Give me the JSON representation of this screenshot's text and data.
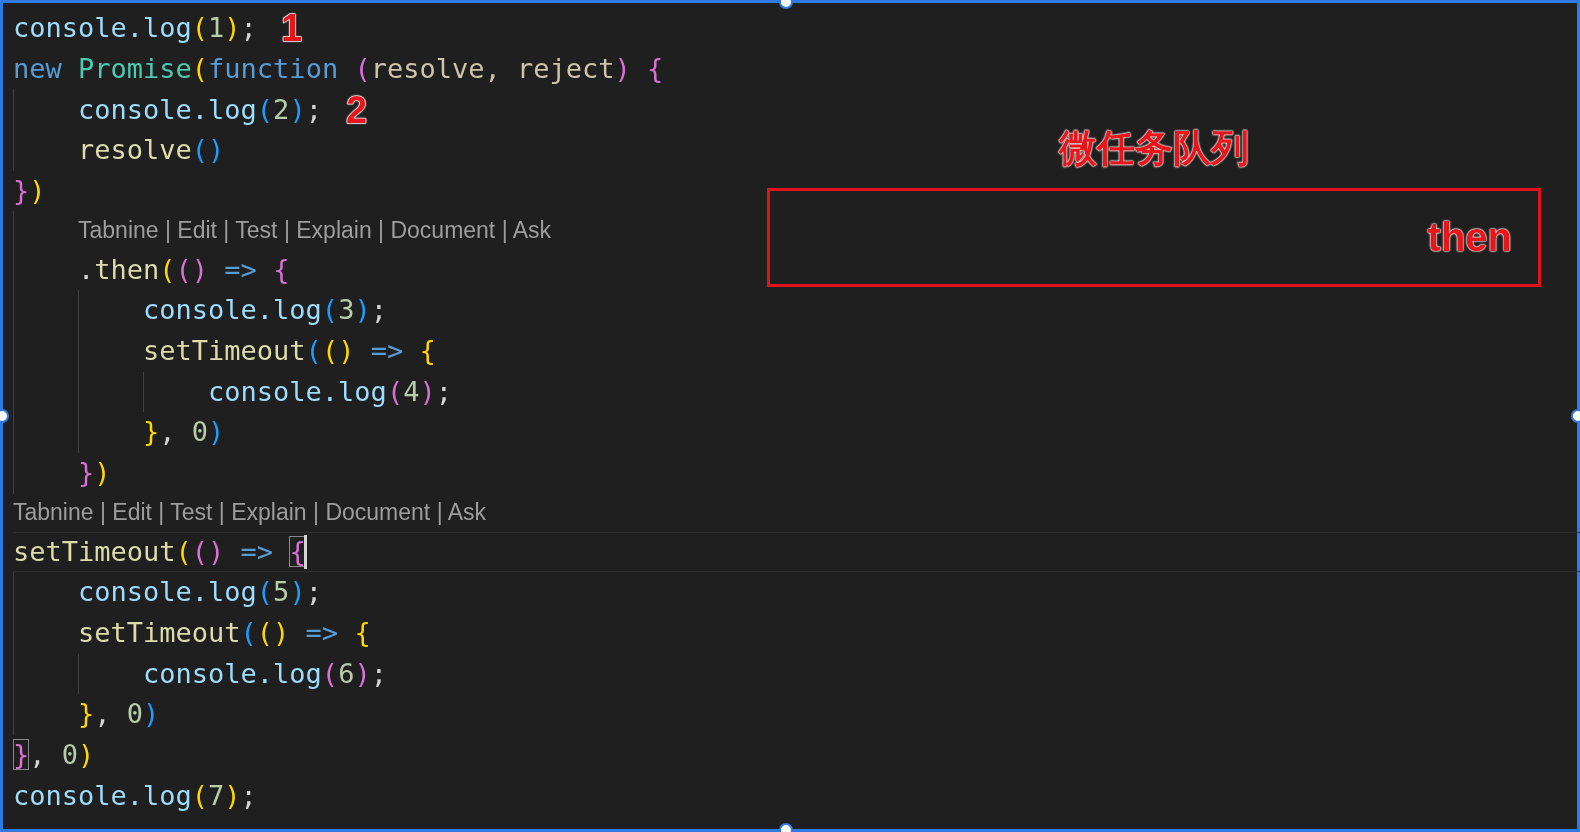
{
  "editor": {
    "lines": [
      {
        "kind": "code",
        "note": "1",
        "tokens": [
          {
            "text": "console.log",
            "kind": "obj"
          },
          {
            "text": "(",
            "kind": "b1"
          },
          {
            "text": "1",
            "kind": "num"
          },
          {
            "text": ")",
            "kind": "b1"
          },
          {
            "text": ";",
            "kind": "punct"
          }
        ]
      },
      {
        "kind": "code",
        "tokens": [
          {
            "text": "new ",
            "kind": "kw"
          },
          {
            "text": "Promise",
            "kind": "type"
          },
          {
            "text": "(",
            "kind": "b1"
          },
          {
            "text": "function ",
            "kind": "kw"
          },
          {
            "text": "(",
            "kind": "b2"
          },
          {
            "text": "resolve, reject",
            "kind": "param"
          },
          {
            "text": ")",
            "kind": "b2"
          },
          {
            "text": " {",
            "kind": "b2"
          }
        ]
      },
      {
        "kind": "code",
        "note": "2",
        "tokens": [
          {
            "text": "    console.log",
            "kind": "obj"
          },
          {
            "text": "(",
            "kind": "b3"
          },
          {
            "text": "2",
            "kind": "num"
          },
          {
            "text": ")",
            "kind": "b3"
          },
          {
            "text": ";",
            "kind": "punct"
          }
        ]
      },
      {
        "kind": "code",
        "tokens": [
          {
            "text": "    resolve",
            "kind": "fn"
          },
          {
            "text": "()",
            "kind": "b3"
          }
        ]
      },
      {
        "kind": "code",
        "tokens": [
          {
            "text": "}",
            "kind": "b2"
          },
          {
            "text": ")",
            "kind": "b1"
          }
        ]
      },
      {
        "kind": "codelens",
        "text": "Tabnine | Edit | Test | Explain | Document | Ask"
      },
      {
        "kind": "code",
        "tokens": [
          {
            "text": "    .",
            "kind": "punct"
          },
          {
            "text": "then",
            "kind": "fn"
          },
          {
            "text": "(",
            "kind": "b1"
          },
          {
            "text": "()",
            "kind": "b2"
          },
          {
            "text": " => ",
            "kind": "kw"
          },
          {
            "text": "{",
            "kind": "b2"
          }
        ]
      },
      {
        "kind": "code",
        "tokens": [
          {
            "text": "        console.log",
            "kind": "obj"
          },
          {
            "text": "(",
            "kind": "b3"
          },
          {
            "text": "3",
            "kind": "num"
          },
          {
            "text": ")",
            "kind": "b3"
          },
          {
            "text": ";",
            "kind": "punct"
          }
        ]
      },
      {
        "kind": "code",
        "tokens": [
          {
            "text": "        setTimeout",
            "kind": "fn"
          },
          {
            "text": "(",
            "kind": "b3"
          },
          {
            "text": "()",
            "kind": "b1"
          },
          {
            "text": " => ",
            "kind": "kw"
          },
          {
            "text": "{",
            "kind": "b1"
          }
        ]
      },
      {
        "kind": "code",
        "tokens": [
          {
            "text": "            console.log",
            "kind": "obj"
          },
          {
            "text": "(",
            "kind": "b2"
          },
          {
            "text": "4",
            "kind": "num"
          },
          {
            "text": ")",
            "kind": "b2"
          },
          {
            "text": ";",
            "kind": "punct"
          }
        ]
      },
      {
        "kind": "code",
        "tokens": [
          {
            "text": "        }",
            "kind": "b1"
          },
          {
            "text": ", ",
            "kind": "punct"
          },
          {
            "text": "0",
            "kind": "num"
          },
          {
            "text": ")",
            "kind": "b3"
          }
        ]
      },
      {
        "kind": "code",
        "tokens": [
          {
            "text": "    }",
            "kind": "b2"
          },
          {
            "text": ")",
            "kind": "b1"
          }
        ]
      },
      {
        "kind": "codelens",
        "text": "Tabnine | Edit | Test | Explain | Document | Ask"
      },
      {
        "kind": "code",
        "current": true,
        "tokens": [
          {
            "text": "setTimeout",
            "kind": "fn"
          },
          {
            "text": "(",
            "kind": "b1"
          },
          {
            "text": "()",
            "kind": "b2"
          },
          {
            "text": " => ",
            "kind": "kw"
          },
          {
            "text": "{",
            "kind": "b2",
            "matched": true
          }
        ]
      },
      {
        "kind": "code",
        "tokens": [
          {
            "text": "    console.log",
            "kind": "obj"
          },
          {
            "text": "(",
            "kind": "b3"
          },
          {
            "text": "5",
            "kind": "num"
          },
          {
            "text": ")",
            "kind": "b3"
          },
          {
            "text": ";",
            "kind": "punct"
          }
        ]
      },
      {
        "kind": "code",
        "tokens": [
          {
            "text": "    setTimeout",
            "kind": "fn"
          },
          {
            "text": "(",
            "kind": "b3"
          },
          {
            "text": "()",
            "kind": "b1"
          },
          {
            "text": " => ",
            "kind": "kw"
          },
          {
            "text": "{",
            "kind": "b1"
          }
        ]
      },
      {
        "kind": "code",
        "tokens": [
          {
            "text": "        console.log",
            "kind": "obj"
          },
          {
            "text": "(",
            "kind": "b2"
          },
          {
            "text": "6",
            "kind": "num"
          },
          {
            "text": ")",
            "kind": "b2"
          },
          {
            "text": ";",
            "kind": "punct"
          }
        ]
      },
      {
        "kind": "code",
        "tokens": [
          {
            "text": "    }",
            "kind": "b1"
          },
          {
            "text": ", ",
            "kind": "punct"
          },
          {
            "text": "0",
            "kind": "num"
          },
          {
            "text": ")",
            "kind": "b3"
          }
        ]
      },
      {
        "kind": "code",
        "tokens": [
          {
            "text": "}",
            "kind": "b2",
            "matched": true
          },
          {
            "text": ", ",
            "kind": "punct"
          },
          {
            "text": "0",
            "kind": "num"
          },
          {
            "text": ")",
            "kind": "b1"
          }
        ]
      },
      {
        "kind": "code",
        "tokens": [
          {
            "text": "console.log",
            "kind": "obj"
          },
          {
            "text": "(",
            "kind": "b1"
          },
          {
            "text": "7",
            "kind": "num"
          },
          {
            "text": ")",
            "kind": "b1"
          },
          {
            "text": ";",
            "kind": "punct"
          }
        ]
      }
    ]
  },
  "annotation": {
    "title": "微任务队列",
    "queue_items": [
      "then"
    ]
  }
}
